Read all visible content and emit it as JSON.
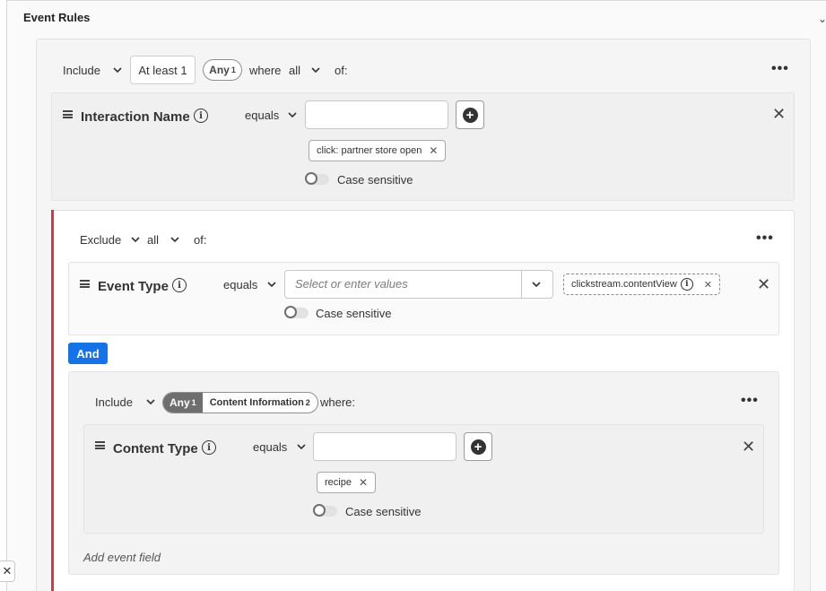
{
  "header": {
    "title": "Event Rules"
  },
  "top_container": {
    "mode": "Include",
    "quantifier": "At least 1",
    "any_label": "Any",
    "any_count": "1",
    "where_label": "where",
    "where_value": "all",
    "of_label": "of:",
    "more": "•••"
  },
  "interaction_rule": {
    "field": "Interaction Name",
    "operator": "equals",
    "input_value": "",
    "tag": "click: partner store open",
    "case_label": "Case sensitive"
  },
  "exclude_container": {
    "mode": "Exclude",
    "where_value": "all",
    "of_label": "of:",
    "more": "•••"
  },
  "event_type_rule": {
    "field": "Event Type",
    "operator": "equals",
    "placeholder": "Select or enter values",
    "tag": "clickstream.contentView",
    "case_label": "Case sensitive"
  },
  "and_button": "And",
  "nested_container": {
    "mode": "Include",
    "any_label": "Any",
    "any_count": "1",
    "object_label": "Content Information",
    "object_count": "2",
    "where_label": "where:",
    "more": "•••"
  },
  "content_type_rule": {
    "field": "Content Type",
    "operator": "equals",
    "input_value": "",
    "tag": "recipe",
    "case_label": "Case sensitive"
  },
  "add_event_field": "Add event field",
  "icons": {
    "chevron": "chevron-down-icon",
    "info": "info-icon",
    "close": "close-icon",
    "plus": "plus-circle-icon",
    "drag": "drag-handle-icon"
  },
  "colors": {
    "accent": "#1473e6",
    "exclude_bar": "#d7373f"
  }
}
